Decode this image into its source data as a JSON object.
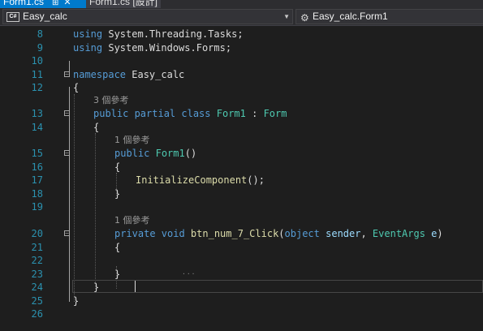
{
  "tabs": [
    {
      "label": "Form1.cs",
      "pin": "⊞",
      "close": "✕"
    },
    {
      "label": "Form1.cs [設計]"
    }
  ],
  "navbar": {
    "project_badge": "C#",
    "project": "Easy_calc",
    "class_member": "Easy_calc.Form1"
  },
  "editor": {
    "line_numbers": [
      "8",
      "9",
      "10",
      "11",
      "12",
      "13",
      "14",
      "15",
      "16",
      "17",
      "18",
      "19",
      "20",
      "21",
      "22",
      "23",
      "24",
      "25",
      "26"
    ],
    "lens_refs": {
      "class": "3 個參考",
      "ctor": "1 個參考",
      "handler": "1 個參考"
    },
    "code": {
      "l8": [
        "using",
        " System.",
        "Threading",
        ".",
        "Tasks",
        ";"
      ],
      "l9": [
        "using",
        " System.",
        "Windows",
        ".",
        "Forms",
        ";"
      ],
      "l11": [
        "namespace",
        " Easy_calc"
      ],
      "l12": "{",
      "l13": [
        "public",
        " partial",
        " class",
        " Form1",
        " : ",
        "Form"
      ],
      "l14": "{",
      "l15": [
        "public",
        " ",
        "Form1",
        "()"
      ],
      "l16": "{",
      "l17": [
        "InitializeComponent",
        "();"
      ],
      "l18": "}",
      "l20": [
        "private",
        " void",
        " btn_num_7_Click",
        "(",
        "object",
        " sender",
        ", ",
        "EventArgs",
        " e",
        ")"
      ],
      "l21": "{",
      "l23": "}",
      "l24": "}",
      "l25": "}"
    }
  }
}
